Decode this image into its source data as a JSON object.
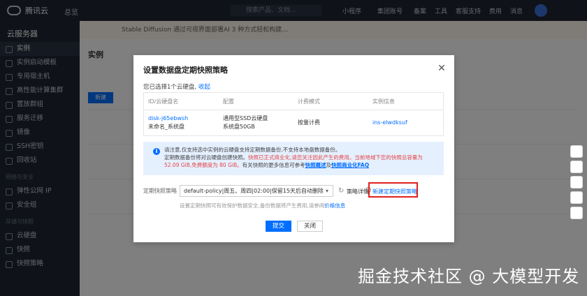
{
  "topbar": {
    "brand": "腾讯云",
    "home": "总览",
    "search_placeholder": "搜索产品、文档...",
    "nav": [
      "小程序",
      "集团账号",
      "备案",
      "工具",
      "客服支持",
      "费用",
      "消息"
    ]
  },
  "sidebar": {
    "title": "云服务器",
    "items": [
      {
        "label": "实例",
        "active": true
      },
      {
        "label": "实例启动模板",
        "active": false
      },
      {
        "label": "专用宿主机",
        "active": false
      },
      {
        "label": "高性能计算集群",
        "active": false
      },
      {
        "label": "置放群组",
        "active": false
      },
      {
        "label": "服务迁移",
        "active": false
      },
      {
        "label": "镜像",
        "active": false
      },
      {
        "label": "SSH密钥",
        "active": false
      },
      {
        "label": "回收站",
        "active": false
      }
    ],
    "group_network": "网络与安全",
    "items2": [
      {
        "label": "弹性公网 IP"
      },
      {
        "label": "安全组"
      }
    ],
    "group_storage": "存储与快照",
    "items3": [
      {
        "label": "云硬盘"
      },
      {
        "label": "快照"
      },
      {
        "label": "快照策略"
      }
    ]
  },
  "background": {
    "notice": "Stable Diffusion 通过可视界面部署AI 3 种方式轻松构建…",
    "page_title": "实例",
    "button_label": "新建"
  },
  "modal": {
    "title": "设置数据盘定期快照策略",
    "selected_prefix": "您已选择1个云硬盘,",
    "selected_link": "收起",
    "table": {
      "headers": [
        "ID/云硬盘名",
        "配置",
        "计费模式",
        "实例信息"
      ],
      "rows": [
        {
          "id": "disk-j65ebwsh",
          "name": "未命名_系统盘",
          "config1": "通用型SSD云硬盘",
          "config2": "系统盘50GB",
          "billing": "按量计费",
          "instance": "ins-elwdksuf"
        }
      ]
    },
    "info": {
      "line1": "请注意,仅支持选中实例的云硬盘支持定期数据备份,不支持本地盘数据备份。",
      "line2_normal": "定期数据备份将对云硬盘创建快照。",
      "line2_red": "快照已正式商业化,请您关注因此产生的费用。当前地域下您的快照总容量为",
      "line3_red": "52.09 GiB,免费额度为 80 GiB。",
      "line3_normal": "有关快照的更多信息可参考",
      "link1": "快照概述",
      "link_sep": "及",
      "link2": "快照商业化FAQ"
    },
    "policy_label": "定期快照策略",
    "policy_value": "default-policy|周五、周四|02:00|保留15天后自动删除",
    "policy_detail": "策略详情",
    "new_policy": "新建定期快照策略",
    "hint_prefix": "设置定期快照可有效保护数据安全,备份数据将产生费用,请参阅",
    "hint_link": "价格信息",
    "ok": "提交",
    "cancel": "关闭"
  },
  "watermark": "掘金技术社区 @ 大模型开发"
}
